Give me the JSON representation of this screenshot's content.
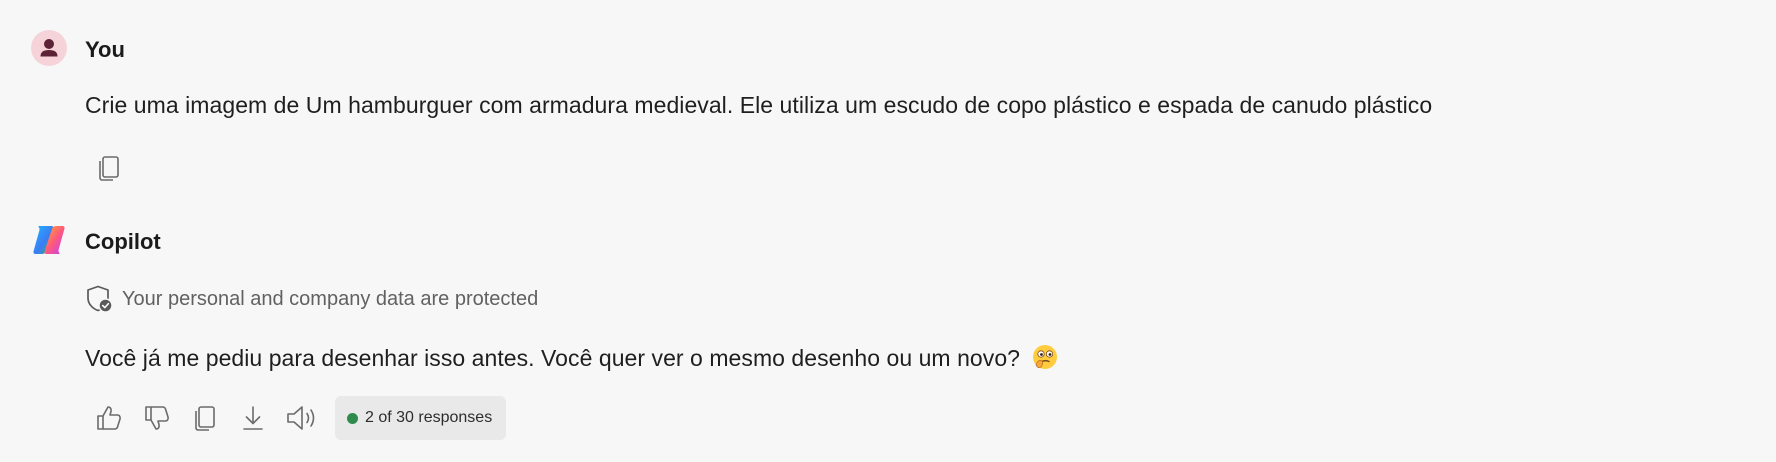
{
  "messages": {
    "user": {
      "sender": "You",
      "avatar_icon": "person-icon",
      "text": "Crie uma imagem de Um hamburguer com armadura medieval. Ele utiliza um escudo de copo plástico e espada de canudo plástico",
      "actions": {
        "copy_icon": "copy-icon"
      }
    },
    "assistant": {
      "sender": "Copilot",
      "avatar_icon": "copilot-logo-icon",
      "protection_notice": "Your personal and company data are protected",
      "protection_icon": "shield-check-icon",
      "text": "Você já me pediu para desenhar isso antes. Você quer ver o mesmo desenho ou um novo?",
      "emoji": "🤔",
      "actions": {
        "icons": [
          "thumbs-up-icon",
          "thumbs-down-icon",
          "copy-icon",
          "download-icon",
          "speaker-icon"
        ],
        "response_counter": "2 of 30 responses",
        "status_color": "#2e8b4c"
      }
    }
  },
  "colors": {
    "background": "#f7f7f7",
    "user_avatar_bg": "#f5d3d8",
    "user_avatar_fg": "#5b2335",
    "counter_bg": "#e9e9e9"
  }
}
